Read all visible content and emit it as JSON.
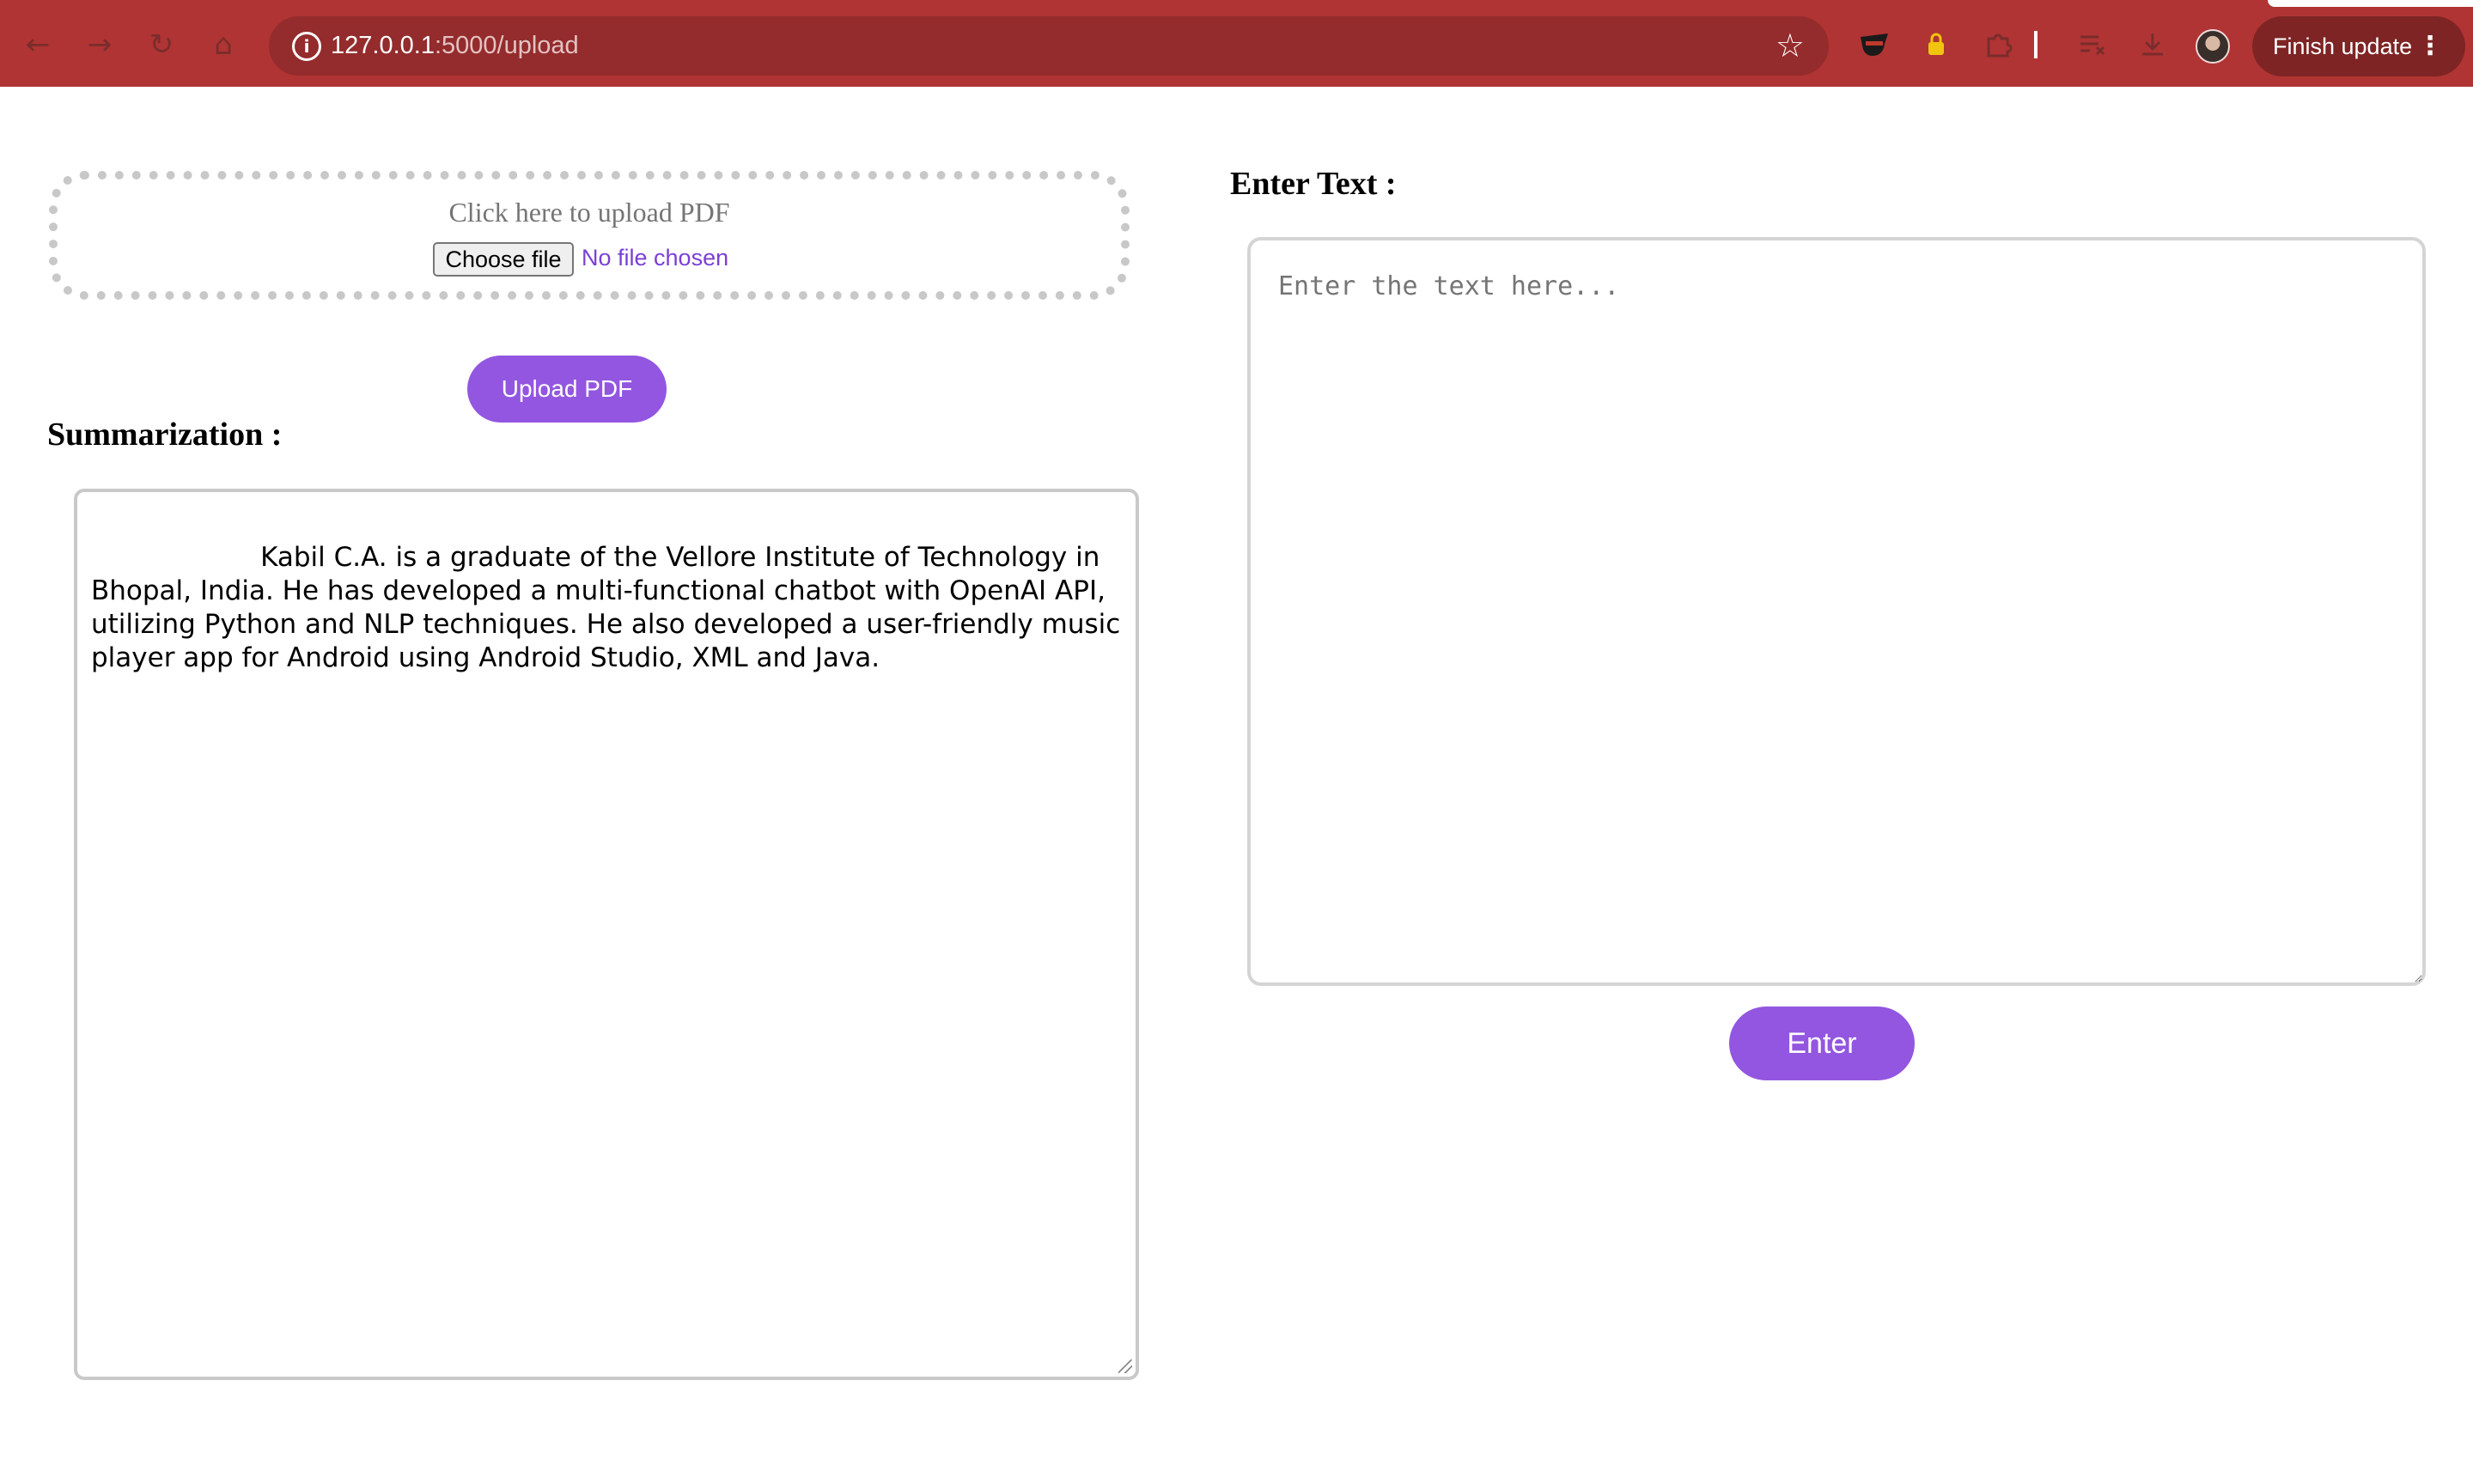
{
  "browser": {
    "url_host": "127.0.0.1",
    "url_path": ":5000/upload",
    "finish_update_label": "Finish update",
    "icons": {
      "back": "arrow-left",
      "forward": "arrow-right",
      "reload": "reload",
      "home": "home",
      "site_info": "info-circle",
      "bookmark": "star",
      "extension_1": "ninja-extension",
      "extension_2": "lock-extension",
      "extensions": "puzzle",
      "reading_list": "reading-list",
      "downloads": "download",
      "menu": "kebab-menu"
    },
    "colors": {
      "toolbar": "#b03433",
      "omnibox": "#942b2c",
      "finish_update_bg": "#7e2424"
    }
  },
  "upload": {
    "title": "Click here to upload PDF",
    "choose_file_label": "Choose file",
    "no_file_text": "No file chosen",
    "upload_button_label": "Upload PDF"
  },
  "summary": {
    "heading": "Summarization :",
    "text": "                  Kabil C.A. is a graduate of the Vellore Institute of Technology in Bhopal, India. He has developed a multi-functional chatbot with OpenAI API, utilizing Python and NLP techniques. He also developed a user-friendly music player app for Android using Android Studio, XML and Java."
  },
  "input": {
    "heading": "Enter Text :",
    "placeholder": "Enter the text here...",
    "value": "",
    "enter_button_label": "Enter"
  },
  "colors": {
    "accent": "#9356e0",
    "no_file_text": "#7a40d6"
  }
}
